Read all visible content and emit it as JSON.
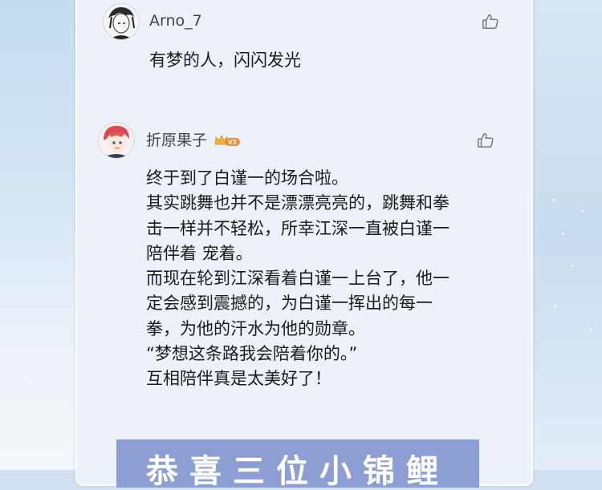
{
  "comments": [
    {
      "username": "Arno_7",
      "text_lines": [
        "有梦的人，闪闪发光"
      ],
      "icon": "thumbs-up-icon"
    },
    {
      "username": "折原果子",
      "badge": "V3",
      "text_lines": [
        "终于到了白谨一的场合啦。",
        "其实跳舞也并不是漂漂亮亮的，跳舞和拳",
        "击一样并不轻松，所幸江深一直被白谨一",
        "陪伴着 宠着。",
        "而现在轮到江深看着白谨一上台了，他一",
        "定会感到震撼的，为白谨一挥出的每一",
        "拳，为他的汗水为他的勋章。",
        "“梦想这条路我会陪着你的。”",
        "互相陪伴真是太美好了！"
      ],
      "icon": "thumbs-up-icon"
    }
  ],
  "banner": {
    "text": "恭喜三位小锦鲤",
    "color": "#8d9ed4"
  }
}
